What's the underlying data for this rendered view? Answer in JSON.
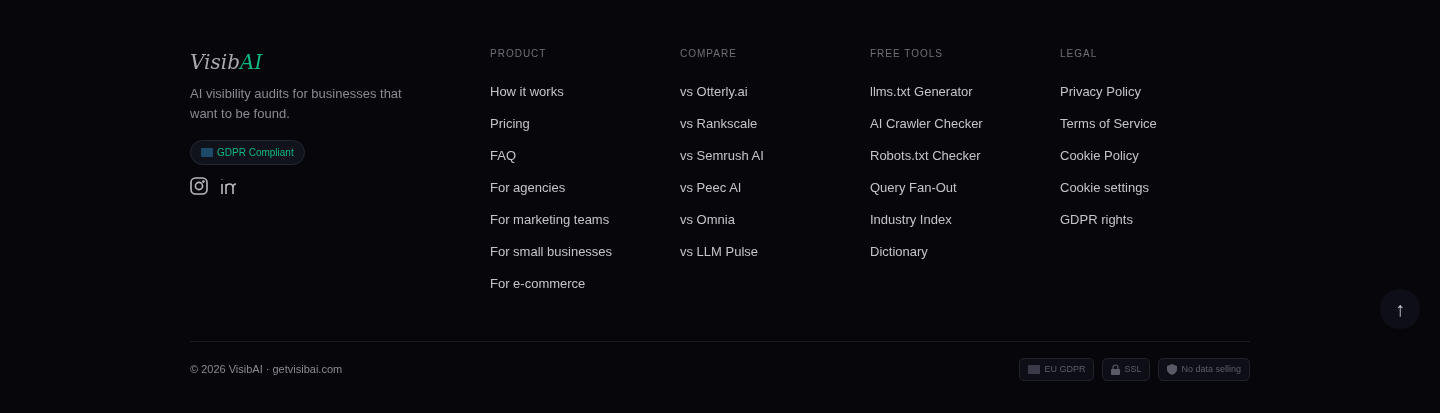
{
  "brand": {
    "name": "Visib",
    "accent": "AI",
    "tagline": "AI visibility audits for businesses that want to be found.",
    "badge": "GDPR Compliant"
  },
  "columns": [
    {
      "heading": "PRODUCT",
      "links": [
        "How it works",
        "Pricing",
        "FAQ",
        "For agencies",
        "For marketing teams",
        "For small businesses",
        "For e-commerce"
      ]
    },
    {
      "heading": "COMPARE",
      "links": [
        "vs Otterly.ai",
        "vs Rankscale",
        "vs Semrush AI",
        "vs Peec AI",
        "vs Omnia",
        "vs LLM Pulse"
      ]
    },
    {
      "heading": "FREE TOOLS",
      "links": [
        "llms.txt Generator",
        "AI Crawler Checker",
        "Robots.txt Checker",
        "Query Fan-Out",
        "Industry Index",
        "Dictionary"
      ]
    },
    {
      "heading": "LEGAL",
      "links": [
        "Privacy Policy",
        "Terms of Service",
        "Cookie Policy",
        "Cookie settings",
        "GDPR rights"
      ]
    }
  ],
  "copyright": "© 2026 VisibAI · getvisibai.com",
  "trust_badges": [
    {
      "kind": "flag",
      "label": "EU GDPR"
    },
    {
      "kind": "lock",
      "label": "SSL"
    },
    {
      "kind": "shield",
      "label": "No data selling"
    }
  ],
  "back_to_top": "↑"
}
